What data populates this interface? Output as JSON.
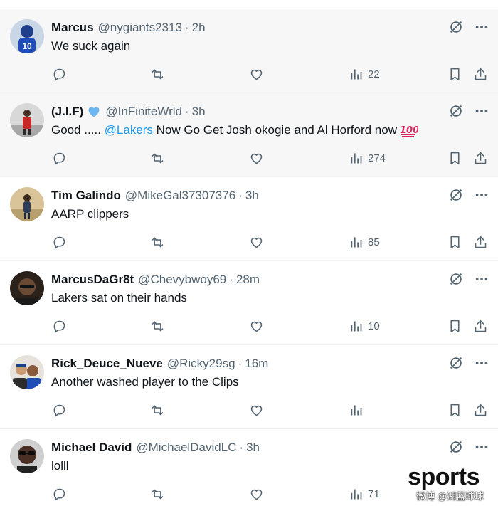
{
  "colors": {
    "text": "#0f1419",
    "secondary": "#536471",
    "link": "#1d9bf0",
    "verified": "#6cb6f2",
    "shaded_row": "#f7f7f7"
  },
  "icons": {
    "reply": "reply-icon",
    "retweet": "retweet-icon",
    "like": "heart-icon",
    "views": "views-chart-icon",
    "bookmark": "bookmark-icon",
    "share": "share-icon",
    "grok": "grok-icon",
    "more": "more-icon"
  },
  "tweets": [
    {
      "name": "Marcus",
      "handle": "@nygiants2313",
      "time": "2h",
      "sep": "·",
      "text": "We suck again",
      "views": "22",
      "shaded": true
    },
    {
      "name": "(J.I.F)",
      "verified": true,
      "handle": "@InFiniteWrld",
      "time": "3h",
      "sep": "·",
      "text_prefix": "Good ..... ",
      "mention": "@Lakers",
      "text_suffix": " Now Go Get Josh okogie and Al Horford now",
      "emoji": "💯",
      "views": "274",
      "shaded": true
    },
    {
      "name": "Tim Galindo",
      "handle": "@MikeGal37307376",
      "time": "3h",
      "sep": "·",
      "text": "AARP clippers",
      "views": "85",
      "shaded": false
    },
    {
      "name": "MarcusDaGr8t",
      "handle": "@Chevybwoy69",
      "time": "28m",
      "sep": "·",
      "text": "Lakers sat on their hands",
      "views": "10",
      "shaded": false
    },
    {
      "name": "Rick_Deuce_Nueve",
      "handle": "@Ricky29sg",
      "time": "16m",
      "sep": "·",
      "text": "Another washed player to the Clips",
      "views": "",
      "shaded": false
    },
    {
      "name": "Michael David",
      "handle": "@MichaelDavidLC",
      "time": "3h",
      "sep": "·",
      "text": "lolll",
      "views": "71",
      "shaded": false
    }
  ],
  "watermark": {
    "brand": "sports",
    "caption": "微博 @湖蓝球球"
  }
}
